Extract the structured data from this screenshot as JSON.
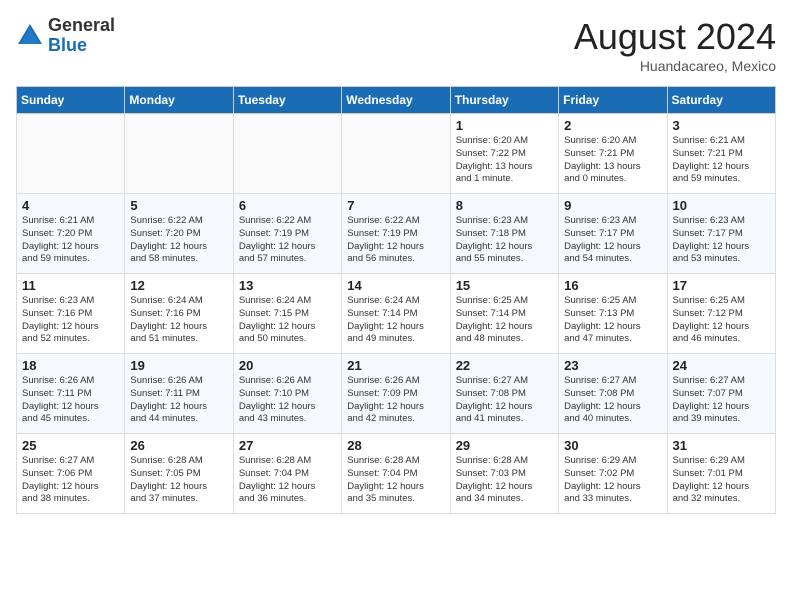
{
  "header": {
    "logo_general": "General",
    "logo_blue": "Blue",
    "month_year": "August 2024",
    "location": "Huandacareo, Mexico"
  },
  "weekdays": [
    "Sunday",
    "Monday",
    "Tuesday",
    "Wednesday",
    "Thursday",
    "Friday",
    "Saturday"
  ],
  "weeks": [
    [
      {
        "day": "",
        "info": ""
      },
      {
        "day": "",
        "info": ""
      },
      {
        "day": "",
        "info": ""
      },
      {
        "day": "",
        "info": ""
      },
      {
        "day": "1",
        "info": "Sunrise: 6:20 AM\nSunset: 7:22 PM\nDaylight: 13 hours\nand 1 minute."
      },
      {
        "day": "2",
        "info": "Sunrise: 6:20 AM\nSunset: 7:21 PM\nDaylight: 13 hours\nand 0 minutes."
      },
      {
        "day": "3",
        "info": "Sunrise: 6:21 AM\nSunset: 7:21 PM\nDaylight: 12 hours\nand 59 minutes."
      }
    ],
    [
      {
        "day": "4",
        "info": "Sunrise: 6:21 AM\nSunset: 7:20 PM\nDaylight: 12 hours\nand 59 minutes."
      },
      {
        "day": "5",
        "info": "Sunrise: 6:22 AM\nSunset: 7:20 PM\nDaylight: 12 hours\nand 58 minutes."
      },
      {
        "day": "6",
        "info": "Sunrise: 6:22 AM\nSunset: 7:19 PM\nDaylight: 12 hours\nand 57 minutes."
      },
      {
        "day": "7",
        "info": "Sunrise: 6:22 AM\nSunset: 7:19 PM\nDaylight: 12 hours\nand 56 minutes."
      },
      {
        "day": "8",
        "info": "Sunrise: 6:23 AM\nSunset: 7:18 PM\nDaylight: 12 hours\nand 55 minutes."
      },
      {
        "day": "9",
        "info": "Sunrise: 6:23 AM\nSunset: 7:17 PM\nDaylight: 12 hours\nand 54 minutes."
      },
      {
        "day": "10",
        "info": "Sunrise: 6:23 AM\nSunset: 7:17 PM\nDaylight: 12 hours\nand 53 minutes."
      }
    ],
    [
      {
        "day": "11",
        "info": "Sunrise: 6:23 AM\nSunset: 7:16 PM\nDaylight: 12 hours\nand 52 minutes."
      },
      {
        "day": "12",
        "info": "Sunrise: 6:24 AM\nSunset: 7:16 PM\nDaylight: 12 hours\nand 51 minutes."
      },
      {
        "day": "13",
        "info": "Sunrise: 6:24 AM\nSunset: 7:15 PM\nDaylight: 12 hours\nand 50 minutes."
      },
      {
        "day": "14",
        "info": "Sunrise: 6:24 AM\nSunset: 7:14 PM\nDaylight: 12 hours\nand 49 minutes."
      },
      {
        "day": "15",
        "info": "Sunrise: 6:25 AM\nSunset: 7:14 PM\nDaylight: 12 hours\nand 48 minutes."
      },
      {
        "day": "16",
        "info": "Sunrise: 6:25 AM\nSunset: 7:13 PM\nDaylight: 12 hours\nand 47 minutes."
      },
      {
        "day": "17",
        "info": "Sunrise: 6:25 AM\nSunset: 7:12 PM\nDaylight: 12 hours\nand 46 minutes."
      }
    ],
    [
      {
        "day": "18",
        "info": "Sunrise: 6:26 AM\nSunset: 7:11 PM\nDaylight: 12 hours\nand 45 minutes."
      },
      {
        "day": "19",
        "info": "Sunrise: 6:26 AM\nSunset: 7:11 PM\nDaylight: 12 hours\nand 44 minutes."
      },
      {
        "day": "20",
        "info": "Sunrise: 6:26 AM\nSunset: 7:10 PM\nDaylight: 12 hours\nand 43 minutes."
      },
      {
        "day": "21",
        "info": "Sunrise: 6:26 AM\nSunset: 7:09 PM\nDaylight: 12 hours\nand 42 minutes."
      },
      {
        "day": "22",
        "info": "Sunrise: 6:27 AM\nSunset: 7:08 PM\nDaylight: 12 hours\nand 41 minutes."
      },
      {
        "day": "23",
        "info": "Sunrise: 6:27 AM\nSunset: 7:08 PM\nDaylight: 12 hours\nand 40 minutes."
      },
      {
        "day": "24",
        "info": "Sunrise: 6:27 AM\nSunset: 7:07 PM\nDaylight: 12 hours\nand 39 minutes."
      }
    ],
    [
      {
        "day": "25",
        "info": "Sunrise: 6:27 AM\nSunset: 7:06 PM\nDaylight: 12 hours\nand 38 minutes."
      },
      {
        "day": "26",
        "info": "Sunrise: 6:28 AM\nSunset: 7:05 PM\nDaylight: 12 hours\nand 37 minutes."
      },
      {
        "day": "27",
        "info": "Sunrise: 6:28 AM\nSunset: 7:04 PM\nDaylight: 12 hours\nand 36 minutes."
      },
      {
        "day": "28",
        "info": "Sunrise: 6:28 AM\nSunset: 7:04 PM\nDaylight: 12 hours\nand 35 minutes."
      },
      {
        "day": "29",
        "info": "Sunrise: 6:28 AM\nSunset: 7:03 PM\nDaylight: 12 hours\nand 34 minutes."
      },
      {
        "day": "30",
        "info": "Sunrise: 6:29 AM\nSunset: 7:02 PM\nDaylight: 12 hours\nand 33 minutes."
      },
      {
        "day": "31",
        "info": "Sunrise: 6:29 AM\nSunset: 7:01 PM\nDaylight: 12 hours\nand 32 minutes."
      }
    ]
  ]
}
